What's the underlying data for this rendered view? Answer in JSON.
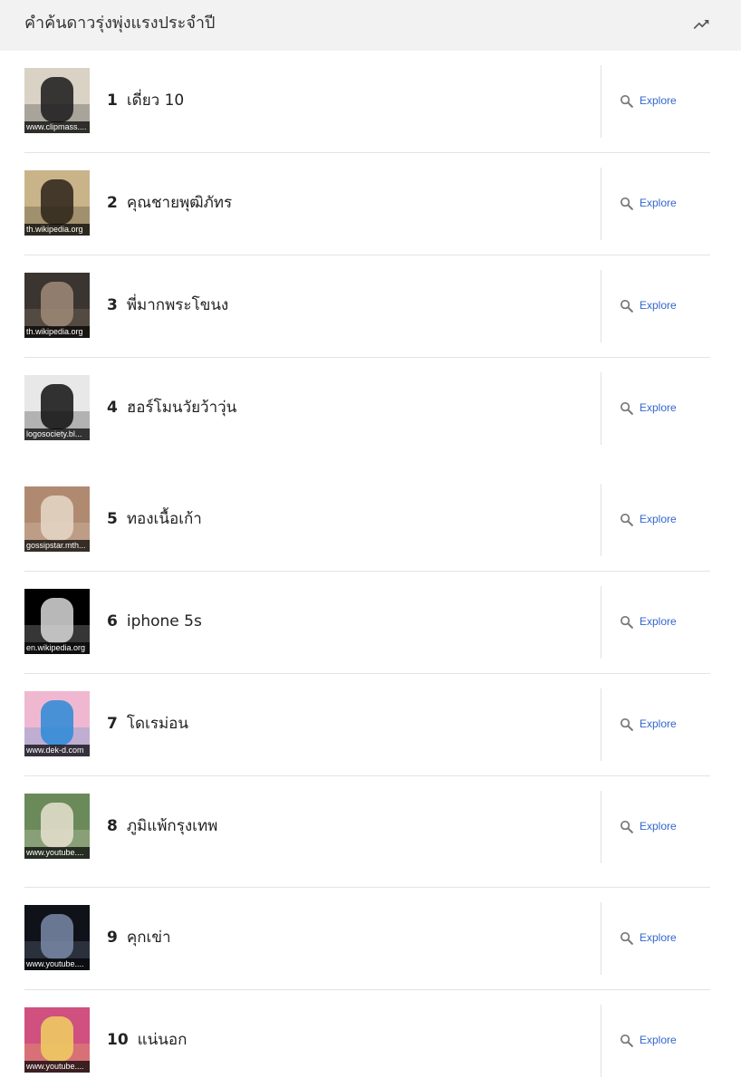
{
  "header": {
    "title": "คำค้นดาวรุ่งพุ่งแรงประจำปี",
    "icon": "trending-up-icon"
  },
  "explore_label": "Explore",
  "colors": {
    "link": "#3366cc",
    "header_bg": "#f2f2f2",
    "divider": "#e3e3e3"
  },
  "items": [
    {
      "rank": "1",
      "query": "เดี่ยว 10",
      "source": "www.clipmass....",
      "thumb_bg": "#d9d2c5",
      "thumb_fg": "#1a1a1a"
    },
    {
      "rank": "2",
      "query": "คุณชายพุฒิภัทร",
      "source": "th.wikipedia.org",
      "thumb_bg": "#c9b48a",
      "thumb_fg": "#2b2218"
    },
    {
      "rank": "3",
      "query": "พี่มากพระโขนง",
      "source": "th.wikipedia.org",
      "thumb_bg": "#3a3530",
      "thumb_fg": "#a08a78"
    },
    {
      "rank": "4",
      "query": "ฮอร์โมนวัยว้าวุ่น",
      "source": "logosociety.bl...",
      "thumb_bg": "#e8e8e8",
      "thumb_fg": "#111111"
    },
    {
      "rank": "5",
      "query": "ทองเนื้อเก้า",
      "source": "gossipstar.mth...",
      "thumb_bg": "#b08a70",
      "thumb_fg": "#e8d8c8"
    },
    {
      "rank": "6",
      "query": "iphone 5s",
      "source": "en.wikipedia.org",
      "thumb_bg": "#000000",
      "thumb_fg": "#d8d8d8"
    },
    {
      "rank": "7",
      "query": "โดเรม่อน",
      "source": "www.dek-d.com",
      "thumb_bg": "#f0b8d0",
      "thumb_fg": "#2a8ad8"
    },
    {
      "rank": "8",
      "query": "ภูมิแพ้กรุงเทพ",
      "source": "www.youtube....",
      "thumb_bg": "#6a8a5a",
      "thumb_fg": "#e8e0d0"
    },
    {
      "rank": "9",
      "query": "คุกเข่า",
      "source": "www.youtube....",
      "thumb_bg": "#10121a",
      "thumb_fg": "#7a8aa8"
    },
    {
      "rank": "10",
      "query": "แน่นอก",
      "source": "www.youtube....",
      "thumb_bg": "#d05080",
      "thumb_fg": "#f0d060"
    }
  ]
}
